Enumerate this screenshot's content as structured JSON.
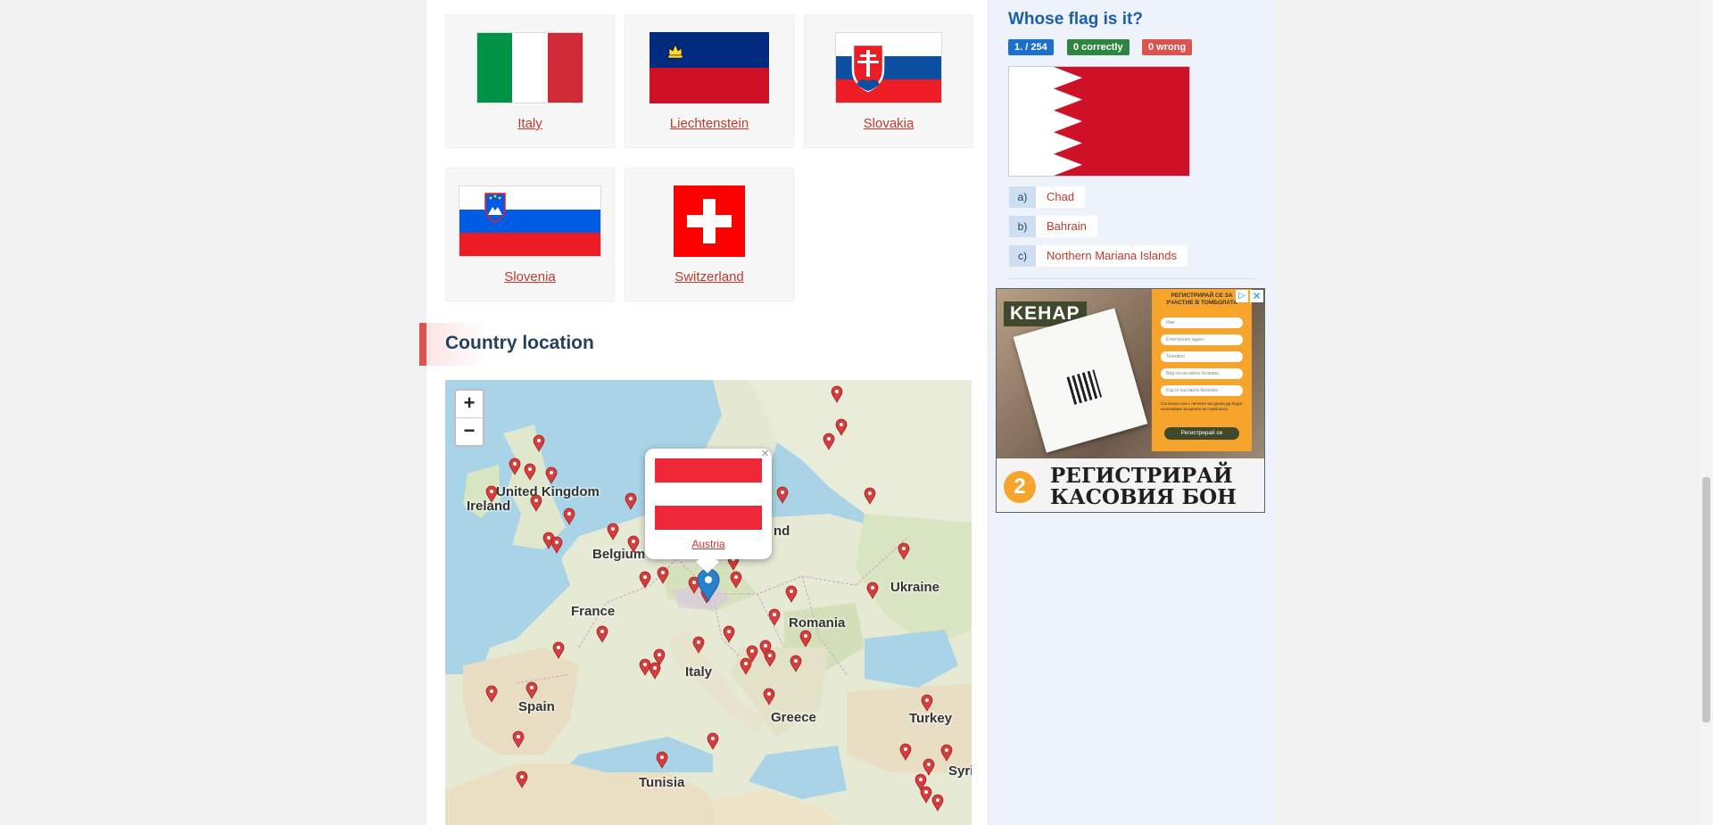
{
  "flags": [
    {
      "name": "Italy"
    },
    {
      "name": "Liechtenstein"
    },
    {
      "name": "Slovakia"
    },
    {
      "name": "Slovenia"
    },
    {
      "name": "Switzerland"
    }
  ],
  "section": {
    "title": "Country location"
  },
  "map": {
    "zoom_in": "+",
    "zoom_out": "−",
    "labels": [
      "United Kingdom",
      "Ireland",
      "Belgium",
      "nd",
      "France",
      "Ukraine",
      "Romania",
      "Italy",
      "Spain",
      "Greece",
      "Turkey",
      "Tunisia",
      "Syri"
    ],
    "popup": {
      "country": "Austria",
      "close": "×"
    }
  },
  "quiz": {
    "title": "Whose flag is it?",
    "counter": "1. / 254",
    "correct": "0  correctly",
    "wrong": "0  wrong",
    "answers": [
      {
        "letter": "a)",
        "text": "Chad"
      },
      {
        "letter": "b)",
        "text": "Bahrain"
      },
      {
        "letter": "c)",
        "text": "Northern Mariana Islands"
      }
    ],
    "colors": {
      "correct": "#2e8540",
      "wrong": "#d9534f",
      "counter": "#1d6fc9"
    }
  },
  "ad": {
    "brand": "KEHAP",
    "header": "РЕГИСТРИРАЙ СЕ ЗА УЧАСТИЕ В ТОМБОЛАТА",
    "form_fields": [
      "Име",
      "Електронен адрес",
      "Телефон",
      "Вид на касовата бележка",
      "Код от касовата бележка"
    ],
    "consent": "Съгласен съм с личните ми данни да бъдат използвани за целите на томболата",
    "submit": "Регистрирай се",
    "step": "2",
    "headline_1": "РЕГИСТРИРАЙ",
    "headline_2": "КАСОВИЯ БОН"
  }
}
